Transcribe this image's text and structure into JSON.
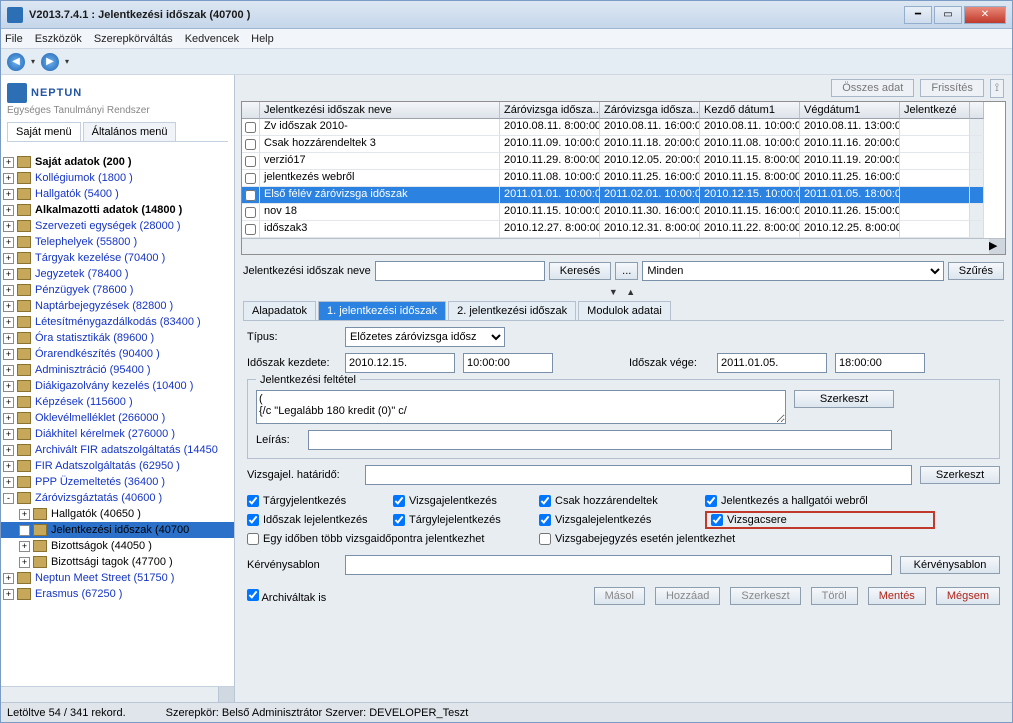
{
  "title": "V2013.7.4.1 : Jelentkezési időszak (40700  )",
  "menu": {
    "file": "File",
    "tools": "Eszközök",
    "role": "Szerepkörváltás",
    "fav": "Kedvencek",
    "help": "Help"
  },
  "topbtn": {
    "all": "Összes adat",
    "refresh": "Frissítés"
  },
  "logo": {
    "main": "NEPTUN",
    "sub": "Egységes Tanulmányi Rendszer"
  },
  "left_tabs": {
    "own": "Saját menü",
    "gen": "Általános menü"
  },
  "tree": {
    "items": [
      {
        "label": "Saját adatok (200  )",
        "bold": true
      },
      {
        "label": "Kollégiumok (1800  )"
      },
      {
        "label": "Hallgatók (5400  )"
      },
      {
        "label": "Alkalmazotti adatok (14800  )",
        "bold": true
      },
      {
        "label": "Szervezeti egységek (28000  )"
      },
      {
        "label": "Telephelyek (55800  )"
      },
      {
        "label": "Tárgyak kezelése (70400  )"
      },
      {
        "label": "Jegyzetek (78400  )"
      },
      {
        "label": "Pénzügyek (78600  )"
      },
      {
        "label": "Naptárbejegyzések (82800  )"
      },
      {
        "label": "Létesítménygazdálkodás (83400  )"
      },
      {
        "label": "Óra statisztikák (89600  )"
      },
      {
        "label": "Órarendkészítés (90400  )"
      },
      {
        "label": "Adminisztráció (95400  )"
      },
      {
        "label": "Diákigazolvány kezelés (10400  )"
      },
      {
        "label": "Képzések (115600  )"
      },
      {
        "label": "Oklevélmelléklet (266000  )"
      },
      {
        "label": "Diákhitel kérelmek (276000  )"
      },
      {
        "label": "Archivált FIR adatszolgáltatás (14450"
      },
      {
        "label": "FIR Adatszolgáltatás (62950  )"
      },
      {
        "label": "PPP Üzemeltetés (36400  )"
      },
      {
        "label": "Záróvizsgáztatás (40600  )",
        "exp": "-"
      },
      {
        "label": "Hallgatók (40650  )",
        "child": true,
        "black": true
      },
      {
        "label": "Jelentkezési időszak (40700",
        "child": true,
        "black": true,
        "sel": true,
        "exp": "+"
      },
      {
        "label": "Bizottságok (44050  )",
        "child": true,
        "black": true
      },
      {
        "label": "Bizottsági tagok (47700  )",
        "child": true,
        "black": true
      },
      {
        "label": "Neptun Meet Street (51750  )"
      },
      {
        "label": "Erasmus (67250  )"
      }
    ]
  },
  "grid": {
    "headers": [
      "",
      "Jelentkezési időszak neve",
      "Záróvizsga idősza...",
      "Záróvizsga idősza...",
      "Kezdő dátum1",
      "Végdátum1",
      "Jelentkezé"
    ],
    "rows": [
      [
        "",
        "Zv időszak 2010-",
        "2010.08.11. 8:00:00",
        "2010.08.11. 16:00:0",
        "2010.08.11. 10:00:0",
        "2010.08.11. 13:00:0",
        ""
      ],
      [
        "",
        "Csak hozzárendeltek 3",
        "2010.11.09. 10:00:0",
        "2010.11.18. 20:00:0",
        "2010.11.08. 10:00:0",
        "2010.11.16. 20:00:0",
        ""
      ],
      [
        "",
        "verzió17",
        "2010.11.29. 8:00:00",
        "2010.12.05. 20:00:0",
        "2010.11.15. 8:00:00",
        "2010.11.19. 20:00:0",
        ""
      ],
      [
        "",
        "jelentkezés webről",
        "2010.11.08. 10:00:0",
        "2010.11.25. 16:00:0",
        "2010.11.15. 8:00:00",
        "2010.11.25. 16:00:0",
        ""
      ],
      [
        "",
        "Első félév záróvizsga időszak",
        "2011.01.01. 10:00:0",
        "2011.02.01. 10:00:0",
        "2010.12.15. 10:00:0",
        "2011.01.05. 18:00:0 (",
        ""
      ],
      [
        "",
        "nov 18",
        "2010.11.15. 10:00:0",
        "2010.11.30. 16:00:0",
        "2010.11.15. 16:00:0",
        "2010.11.26. 15:00:0",
        ""
      ],
      [
        "",
        "időszak3",
        "2010.12.27. 8:00:00",
        "2010.12.31. 8:00:00",
        "2010.11.22. 8:00:00",
        "2010.12.25. 8:00:00",
        ""
      ]
    ],
    "sel": 4
  },
  "search": {
    "label": "Jelentkezési időszak neve",
    "value": "",
    "btn_search": "Keresés",
    "btn_dots": "...",
    "filter_value": "Minden",
    "btn_filter": "Szűrés"
  },
  "inner_tabs": {
    "t0": "Alapadatok",
    "t1": "1. jelentkezési időszak",
    "t2": "2. jelentkezési időszak",
    "t3": "Modulok adatai"
  },
  "form": {
    "type_label": "Típus:",
    "type_value": "Előzetes záróvizsga idősz",
    "start_label": "Időszak kezdete:",
    "start_date": "2010.12.15.",
    "start_time": "10:00:00",
    "end_label": "Időszak vége:",
    "end_date": "2011.01.05.",
    "end_time": "18:00:00",
    "fs_title": "Jelentkezési feltétel",
    "cond_text": "(\n{/c \"Legalább 180 kredit (0)\" c/",
    "btn_edit": "Szerkeszt",
    "desc_label": "Leírás:",
    "desc_value": "",
    "deadline_label": "Vizsgajel. határidő:",
    "deadline_value": "",
    "chk": {
      "c1": "Tárgyjelentkezés",
      "c2": "Vizsgajelentkezés",
      "c3": "Csak hozzárendeltek",
      "c4": "Jelentkezés a hallgatói webről",
      "c5": "Időszak lejelentkezés",
      "c6": "Tárgylejelentkezés",
      "c7": "Vizsgalejelentkezés",
      "c8": "Vizsgacsere",
      "c9": "Egy időben több vizsgaidőpontra jelentkezhet",
      "c10": "Vizsgabejegyzés esetén jelentkezhet"
    },
    "tpl_label": "Kérvénysablon",
    "tpl_value": "",
    "tpl_btn": "Kérvénysablon"
  },
  "actions": {
    "arch": "Archiváltak is",
    "copy": "Másol",
    "add": "Hozzáad",
    "edit": "Szerkeszt",
    "del": "Töröl",
    "save": "Mentés",
    "cancel": "Mégsem"
  },
  "status": {
    "loaded": "Letöltve 54 / 341 rekord.",
    "role": "Szerepkör: Belső Adminisztrátor  Szerver: DEVELOPER_Teszt"
  }
}
